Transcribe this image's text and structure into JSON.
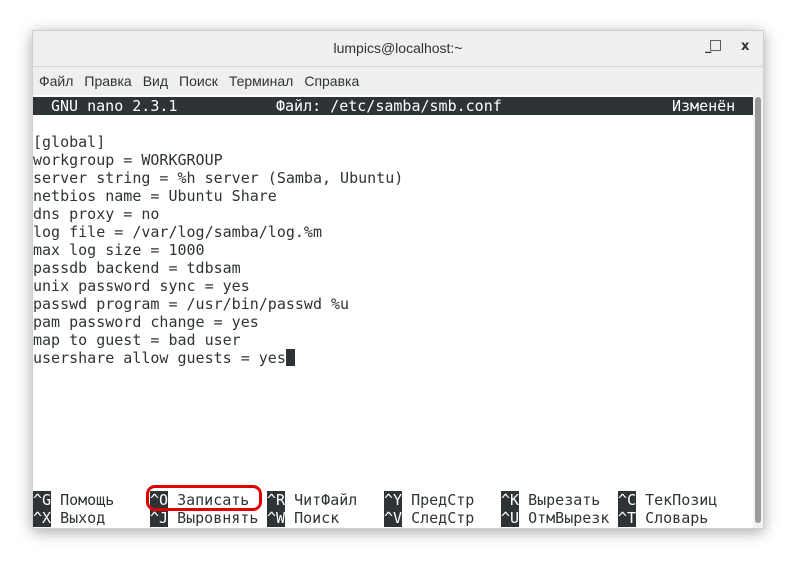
{
  "window": {
    "title": "lumpics@localhost:~",
    "minimize": "_",
    "maximize": "□",
    "close": "x"
  },
  "menu": [
    "Файл",
    "Правка",
    "Вид",
    "Поиск",
    "Терминал",
    "Справка"
  ],
  "nano": {
    "version": "GNU nano 2.3.1",
    "file": "Файл: /etc/samba/smb.conf",
    "status": "Изменён"
  },
  "content": [
    "[global]",
    "workgroup = WORKGROUP",
    "server string = %h server (Samba, Ubuntu)",
    "netbios name = Ubuntu Share",
    "dns proxy = no",
    "log file = /var/log/samba/log.%m",
    "max log size = 1000",
    "passdb backend = tdbsam",
    "unix password sync = yes",
    "passwd program = /usr/bin/passwd %u",
    "pam password change = yes",
    "map to guest = bad user",
    "usershare allow guests = yes"
  ],
  "shortcuts": [
    [
      {
        "key": "^G",
        "label": "Помощь"
      },
      {
        "key": "^O",
        "label": "Записать"
      },
      {
        "key": "^R",
        "label": "ЧитФайл"
      },
      {
        "key": "^Y",
        "label": "ПредСтр"
      },
      {
        "key": "^K",
        "label": "Вырезать"
      },
      {
        "key": "^C",
        "label": "ТекПозиц"
      }
    ],
    [
      {
        "key": "^X",
        "label": "Выход"
      },
      {
        "key": "^J",
        "label": "Выровнять"
      },
      {
        "key": "^W",
        "label": "Поиск"
      },
      {
        "key": "^V",
        "label": "СледСтр"
      },
      {
        "key": "^U",
        "label": "ОтмВырезк"
      },
      {
        "key": "^T",
        "label": "Словарь"
      }
    ]
  ],
  "highlight_color": "#e00000"
}
